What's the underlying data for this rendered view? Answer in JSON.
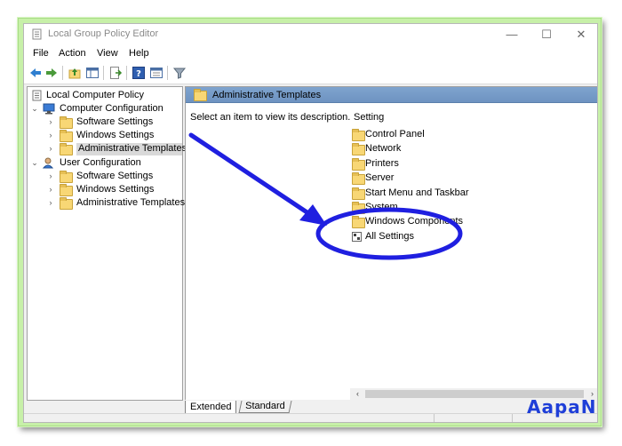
{
  "window": {
    "title": "Local Group Policy Editor",
    "controls": {
      "minimize": "—",
      "maximize": "☐",
      "close": "✕"
    }
  },
  "menu": [
    "File",
    "Action",
    "View",
    "Help"
  ],
  "toolbar": {
    "icons": [
      "back-arrow-icon",
      "forward-arrow-icon",
      "up-folder-icon",
      "show-hide-tree-icon",
      "export-list-icon",
      "help-icon",
      "properties-icon",
      "filter-icon"
    ]
  },
  "tree": {
    "root": "Local Computer Policy",
    "computer_config": "Computer Configuration",
    "computer_children": [
      "Software Settings",
      "Windows Settings",
      "Administrative Templates"
    ],
    "user_config": "User Configuration",
    "user_children": [
      "Software Settings",
      "Windows Settings",
      "Administrative Templates"
    ]
  },
  "right_pane": {
    "header": "Administrative Templates",
    "description": "Select an item to view its description.",
    "column_header": "Setting",
    "items": [
      "Control Panel",
      "Network",
      "Printers",
      "Server",
      "Start Menu and Taskbar",
      "System",
      "Windows Components",
      "All Settings"
    ]
  },
  "tabs": [
    "Extended",
    "Standard"
  ],
  "watermark": "AapaN",
  "colors": {
    "frame": "#c7f0a8",
    "header": "#7fa4ce",
    "annotation": "#1f1fe0",
    "folder": "#f8d775"
  }
}
